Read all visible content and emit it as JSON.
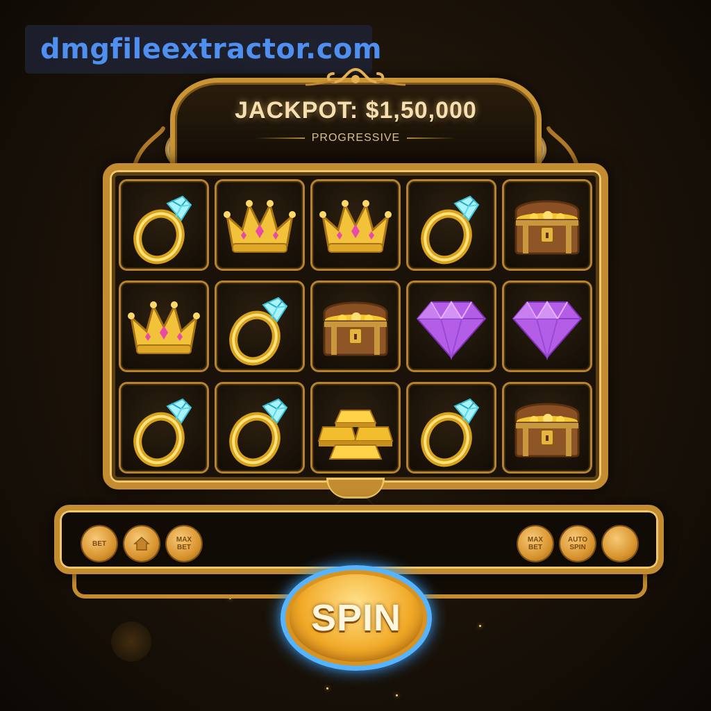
{
  "watermark": {
    "text": "dmgfileextractor.com"
  },
  "header": {
    "jackpot_label": "JACKPOT: $1,50,000",
    "jackpot_type": "PROGRESSIVE"
  },
  "reels": [
    [
      "diamond-ring-icon",
      "crown-icon",
      "crown-icon",
      "diamond-ring-icon",
      "treasure-chest-icon"
    ],
    [
      "crown-icon",
      "diamond-ring-icon",
      "treasure-chest-icon",
      "purple-gem-icon",
      "purple-gem-icon"
    ],
    [
      "diamond-ring-icon",
      "diamond-ring-icon",
      "gold-bars-icon",
      "diamond-ring-icon",
      "treasure-chest-icon"
    ]
  ],
  "controls": {
    "left": [
      {
        "label": "BET",
        "name": "bet-button"
      },
      {
        "label": "",
        "name": "home-button",
        "icon": "home-icon"
      },
      {
        "label": "MAX BET",
        "name": "max-bet-button"
      }
    ],
    "right": [
      {
        "label": "MAX BET",
        "name": "max-bet-button-right"
      },
      {
        "label": "AUTO SPIN",
        "name": "auto-spin-button"
      },
      {
        "label": "",
        "name": "blank-round-button"
      }
    ]
  },
  "spin": {
    "label": "SPIN"
  },
  "colors": {
    "gold": "#c38c30",
    "gold_light": "#f0c86a",
    "spin_glow": "#56b4ff",
    "gem_purple": "#b45ee8",
    "diamond_cyan": "#6fe3f0"
  }
}
